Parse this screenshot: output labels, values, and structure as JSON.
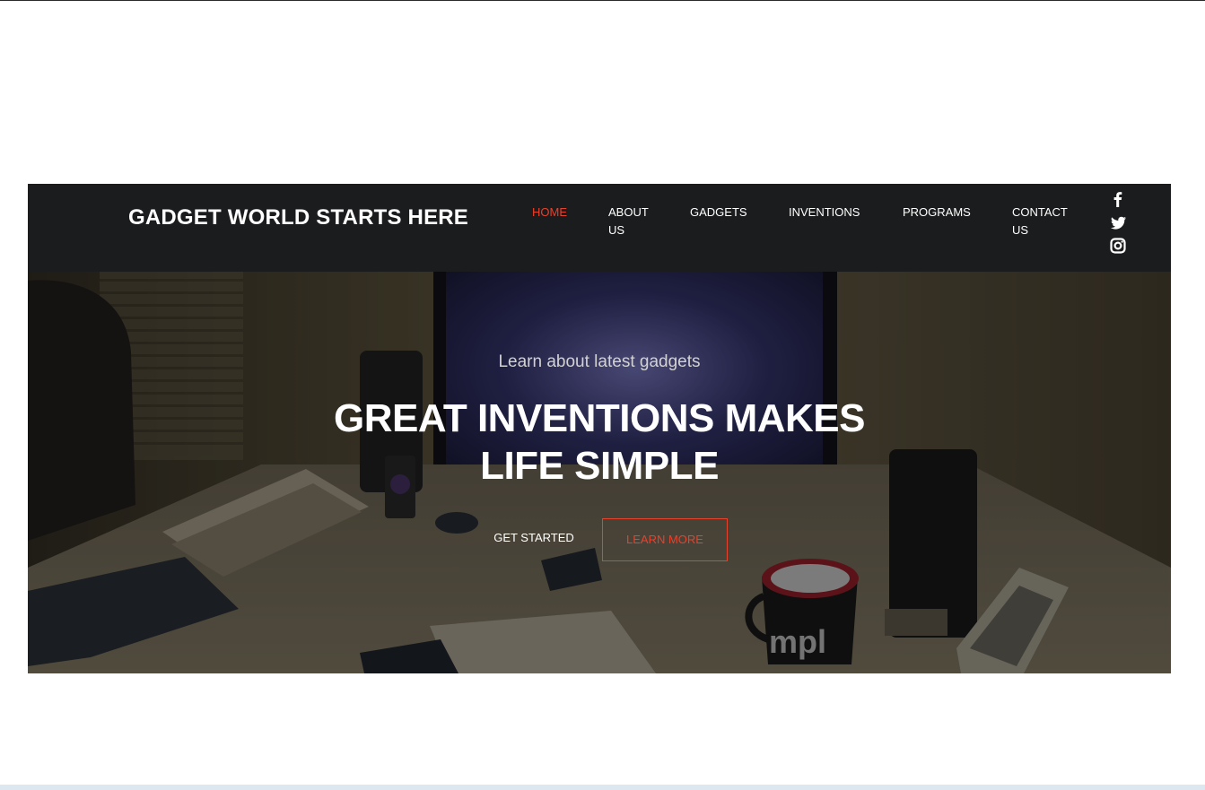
{
  "navbar": {
    "brand": "GADGET WORLD STARTS HERE",
    "links": [
      {
        "label_lines": [
          "HOME"
        ],
        "active": true
      },
      {
        "label_lines": [
          "ABOUT",
          "US"
        ],
        "active": false
      },
      {
        "label_lines": [
          "GADGETS"
        ],
        "active": false
      },
      {
        "label_lines": [
          "INVENTIONS"
        ],
        "active": false
      },
      {
        "label_lines": [
          "PROGRAMS"
        ],
        "active": false
      },
      {
        "label_lines": [
          "CONTACT",
          "US"
        ],
        "active": false
      }
    ],
    "social_icons": [
      "facebook-icon",
      "twitter-icon",
      "instagram-icon"
    ]
  },
  "hero": {
    "subtitle": "Learn about latest gadgets",
    "title_lines": [
      "GREAT INVENTIONS MAKES",
      "LIFE SIMPLE"
    ],
    "primary_button": "GET STARTED",
    "secondary_button": "LEARN MORE",
    "mug_text": "mpl"
  },
  "colors": {
    "accent": "#e8412c",
    "navbar_bg": "#1b1c1e",
    "text": "#ffffff"
  }
}
